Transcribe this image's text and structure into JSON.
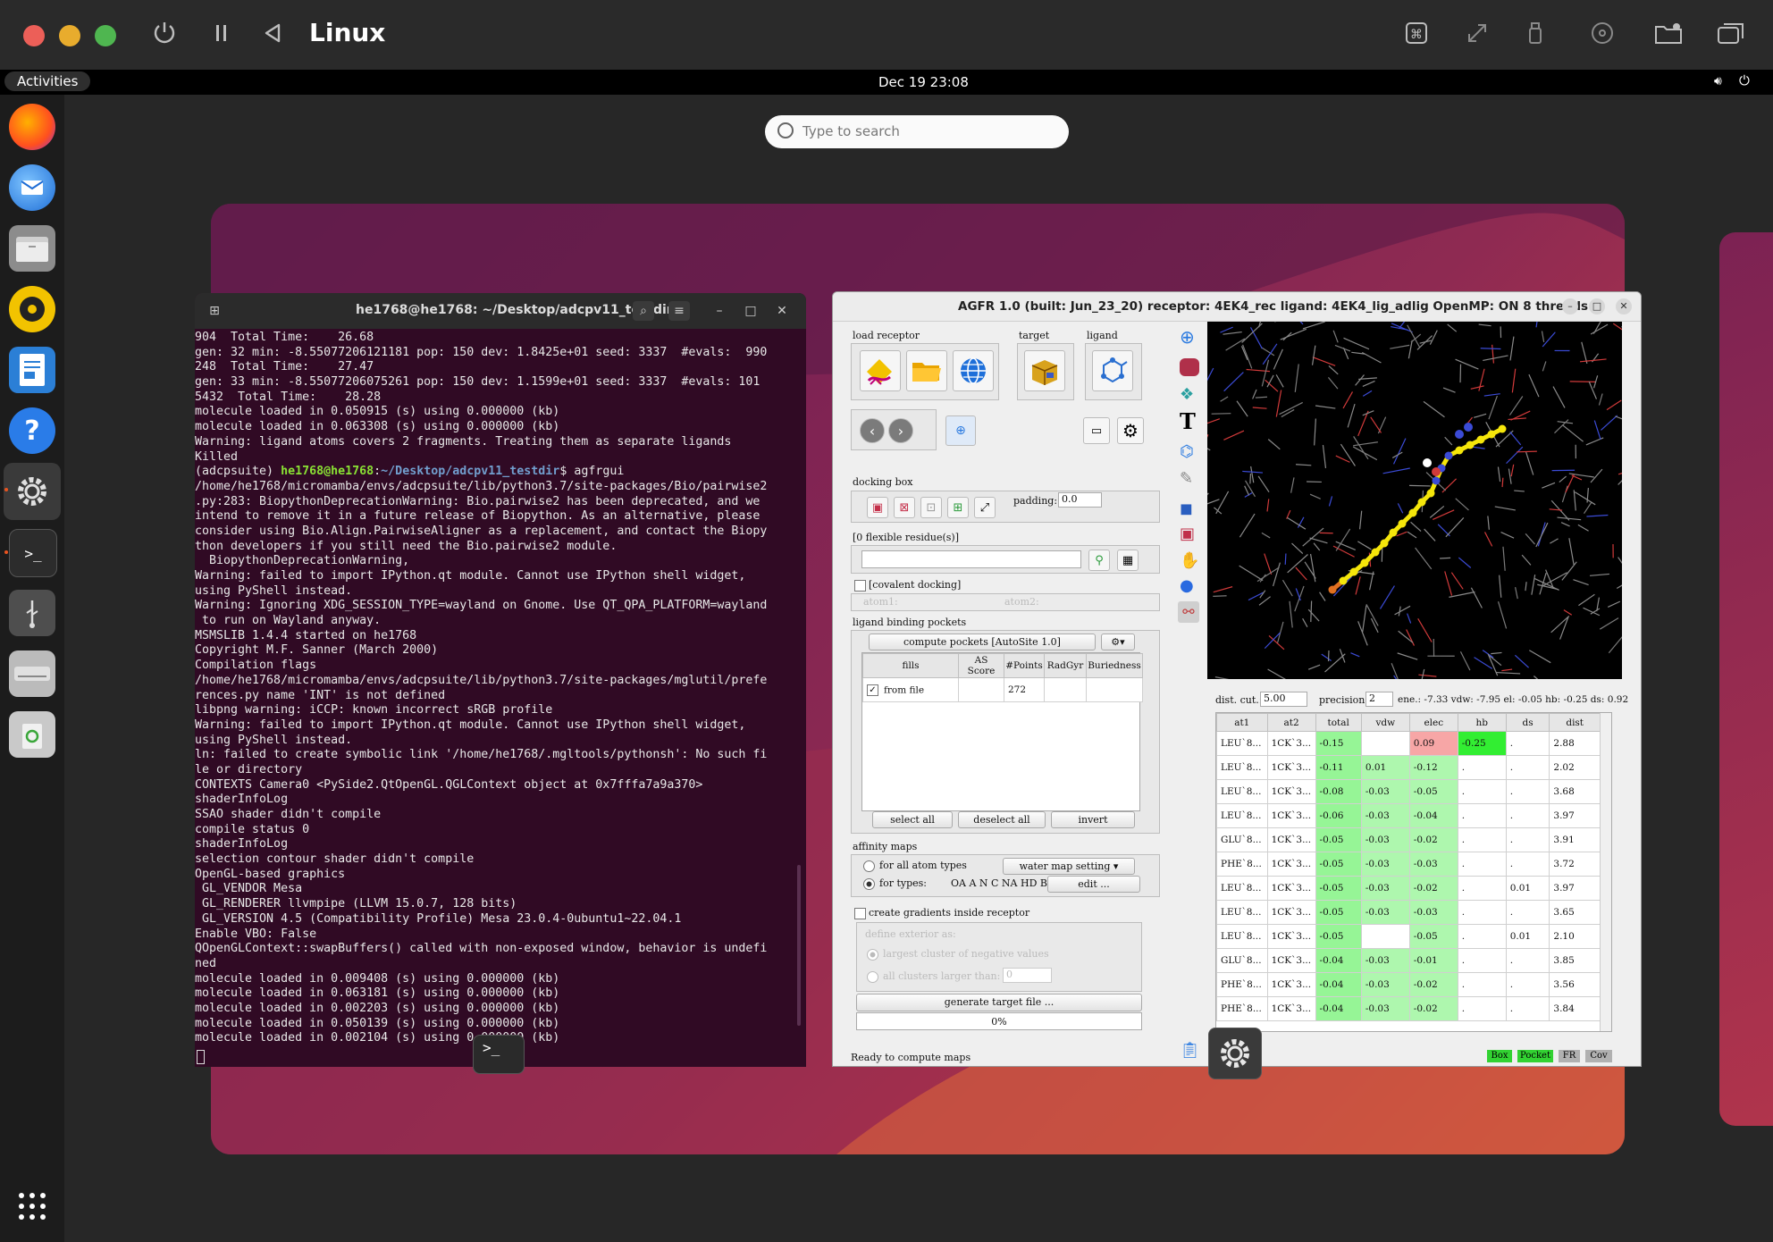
{
  "host": {
    "title": "Linux",
    "traffic_lights": {
      "close": "#ec5f58",
      "minimize": "#e8ac2d",
      "zoom": "#4fb650"
    },
    "left_icons": [
      "power-icon",
      "pause-icon",
      "back-icon"
    ],
    "right_icons": [
      "command-icon",
      "resize-icon",
      "usb-icon",
      "cd-icon",
      "shared-folder-icon",
      "windows-icon"
    ]
  },
  "topbar": {
    "activities": "Activities",
    "clock": "Dec 19  23:08",
    "icons": [
      "volume-icon",
      "power-icon"
    ]
  },
  "search": {
    "placeholder": "Type to search"
  },
  "dock": {
    "apps": [
      "firefox",
      "thunderbird",
      "files",
      "rhythmbox",
      "writer",
      "help",
      "settings",
      "terminal",
      "usb",
      "drive",
      "trash"
    ],
    "show_apps": "show-apps-icon"
  },
  "terminal": {
    "title": "he1768@he1768: ~/Desktop/adcpv11_testdir",
    "lines": [
      "904  Total Time:    26.68",
      "gen: 32 min: -8.55077206121181 pop: 150 dev: 1.8425e+01 seed: 3337  #evals:  990",
      "248  Total Time:    27.47",
      "gen: 33 min: -8.55077206075261 pop: 150 dev: 1.1599e+01 seed: 3337  #evals: 101",
      "5432  Total Time:    28.28",
      "molecule loaded in 0.050915 (s) using 0.000000 (kb)",
      "molecule loaded in 0.063308 (s) using 0.000000 (kb)",
      "Warning: ligand atoms covers 2 fragments. Treating them as separate ligands",
      "Killed",
      "__PROMPT__",
      "/home/he1768/micromamba/envs/adcpsuite/lib/python3.7/site-packages/Bio/pairwise2",
      ".py:283: BiopythonDeprecationWarning: Bio.pairwise2 has been deprecated, and we",
      "intend to remove it in a future release of Biopython. As an alternative, please",
      "consider using Bio.Align.PairwiseAligner as a replacement, and contact the Biopy",
      "thon developers if you still need the Bio.pairwise2 module.",
      "  BiopythonDeprecationWarning,",
      "Warning: failed to import IPython.qt module. Cannot use IPython shell widget,",
      "using PyShell instead.",
      "Warning: Ignoring XDG_SESSION_TYPE=wayland on Gnome. Use QT_QPA_PLATFORM=wayland",
      " to run on Wayland anyway.",
      "MSMSLIB 1.4.4 started on he1768",
      "Copyright M.F. Sanner (March 2000)",
      "Compilation flags",
      "/home/he1768/micromamba/envs/adcpsuite/lib/python3.7/site-packages/mglutil/prefe",
      "rences.py name 'INT' is not defined",
      "libpng warning: iCCP: known incorrect sRGB profile",
      "Warning: failed to import IPython.qt module. Cannot use IPython shell widget,",
      "using PyShell instead.",
      "ln: failed to create symbolic link '/home/he1768/.mgltools/pythonsh': No such fi",
      "le or directory",
      "CONTEXTS Camera0 <PySide2.QtOpenGL.QGLContext object at 0x7fffa7a9a370>",
      "shaderInfoLog",
      "SSAO shader didn't compile",
      "compile status 0",
      "shaderInfoLog",
      "selection contour shader didn't compile",
      "OpenGL-based graphics",
      " GL_VENDOR Mesa",
      " GL_RENDERER llvmpipe (LLVM 15.0.7, 128 bits)",
      " GL_VERSION 4.5 (Compatibility Profile) Mesa 23.0.4-0ubuntu1~22.04.1",
      "Enable VBO: False",
      "QOpenGLContext::swapBuffers() called with non-exposed window, behavior is undefi",
      "ned",
      "molecule loaded in 0.009408 (s) using 0.000000 (kb)",
      "molecule loaded in 0.063181 (s) using 0.000000 (kb)",
      "molecule loaded in 0.002203 (s) using 0.000000 (kb)",
      "molecule loaded in 0.050139 (s) using 0.000000 (kb)",
      "molecule loaded in 0.002104 (s) using 0.000000 (kb)"
    ],
    "prompt": {
      "env": "(adcpsuite) ",
      "user": "he1768@he1768",
      "sep": ":",
      "path": "~/Desktop/adcpv11_testdir",
      "dollar": "$ ",
      "cmd": "agfrgui"
    }
  },
  "agfr": {
    "title": "AGFR 1.0 (built: Jun_23_20) receptor: 4EK4_rec   ligand: 4EK4_lig_adlig   OpenMP: ON 8 threads",
    "load_receptor": "load receptor",
    "target": "target",
    "ligand": "ligand",
    "docking_box": "docking box",
    "padding_label": "padding:",
    "padding_value": "0.0",
    "flexible": "[0 flexible residue(s)]",
    "covalent": "[covalent docking]",
    "atom1": "atom1:",
    "atom2": "atom2:",
    "pockets_label": "ligand binding pockets",
    "compute_pockets": "compute pockets [AutoSite 1.0]",
    "pocket_cols": [
      "fills",
      "AS Score",
      "#Points",
      "RadGyr",
      "Buriedness"
    ],
    "pocket_rows": [
      {
        "fills": "from file",
        "as_score": "",
        "points": "272",
        "radgyr": "",
        "buried": ""
      }
    ],
    "select_all": "select all",
    "deselect_all": "deselect all",
    "invert": "invert",
    "affinity_maps": "affinity maps",
    "for_all": "for all atom types",
    "water_map": "water map setting",
    "for_types": "for types:",
    "types": "OA A N C NA HD Br",
    "edit": "edit ...",
    "gradients": "create gradients inside receptor",
    "define_exterior": "define exterior as:",
    "largest_cluster": "largest cluster of negative values",
    "all_clusters": "all clusters larger than:",
    "clusters_value": "0",
    "generate": "generate target file ...",
    "progress": "0%",
    "progress_fraction": 0,
    "status": "Ready to compute maps",
    "tags": [
      "Box",
      "Pocket",
      "FR",
      "Cov"
    ],
    "dist_cut_label": "dist. cut.:",
    "dist_cut": "5.00",
    "precision_label": "precision:",
    "precision": "2",
    "energy_summary": "ene.: -7.33 vdw: -7.95 el: -0.05 hb: -0.25 ds: 0.92",
    "inter_cols": [
      "at1",
      "at2",
      "total",
      "vdw",
      "elec",
      "hb",
      "ds",
      "dist"
    ],
    "inter_rows": [
      [
        "LEU`8...",
        "1CK`3...",
        "-0.15",
        "",
        "0.09",
        "-0.25",
        ".",
        "2.88"
      ],
      [
        "LEU`8...",
        "1CK`3...",
        "-0.11",
        "0.01",
        "-0.12",
        ".",
        ".",
        "2.02"
      ],
      [
        "LEU`8...",
        "1CK`3...",
        "-0.08",
        "-0.03",
        "-0.05",
        ".",
        ".",
        "3.68"
      ],
      [
        "LEU`8...",
        "1CK`3...",
        "-0.06",
        "-0.03",
        "-0.04",
        ".",
        ".",
        "3.97"
      ],
      [
        "GLU`8...",
        "1CK`3...",
        "-0.05",
        "-0.03",
        "-0.02",
        ".",
        ".",
        "3.91"
      ],
      [
        "PHE`8...",
        "1CK`3...",
        "-0.05",
        "-0.03",
        "-0.03",
        ".",
        ".",
        "3.72"
      ],
      [
        "LEU`8...",
        "1CK`3...",
        "-0.05",
        "-0.03",
        "-0.02",
        ".",
        "0.01",
        "3.97"
      ],
      [
        "LEU`8...",
        "1CK`3...",
        "-0.05",
        "-0.03",
        "-0.03",
        ".",
        ".",
        "3.65"
      ],
      [
        "LEU`8...",
        "1CK`3...",
        "-0.05",
        "",
        "-0.05",
        ".",
        "0.01",
        "2.10"
      ],
      [
        "GLU`8...",
        "1CK`3...",
        "-0.04",
        "-0.03",
        "-0.01",
        ".",
        ".",
        "3.85"
      ],
      [
        "PHE`8...",
        "1CK`3...",
        "-0.04",
        "-0.03",
        "-0.02",
        ".",
        ".",
        "3.56"
      ],
      [
        "PHE`8...",
        "1CK`3...",
        "-0.04",
        "-0.03",
        "-0.02",
        ".",
        ".",
        "3.84"
      ]
    ]
  },
  "terminal_badge": ">_"
}
